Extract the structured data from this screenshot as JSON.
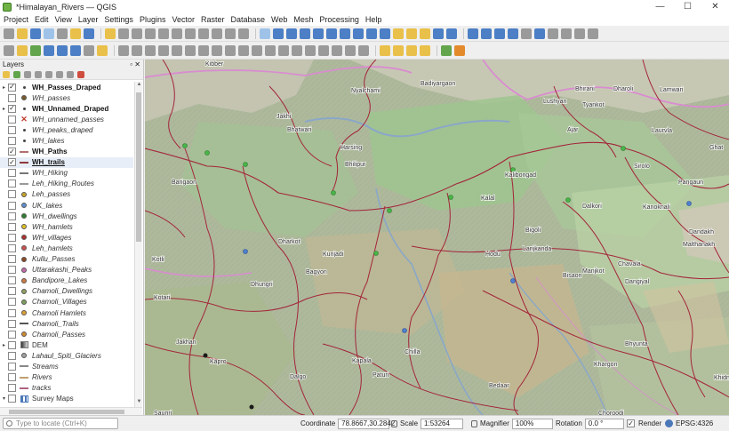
{
  "window": {
    "title": "*Himalayan_Rivers — QGIS",
    "minimize": "—",
    "maximize": "☐",
    "close": "✕"
  },
  "menu": [
    "Project",
    "Edit",
    "View",
    "Layer",
    "Settings",
    "Plugins",
    "Vector",
    "Raster",
    "Database",
    "Web",
    "Mesh",
    "Processing",
    "Help"
  ],
  "layers_panel": {
    "title": "Layers",
    "controls": "▫ ✕",
    "layers": [
      {
        "name": "WH_Passes_Draped",
        "checked": true,
        "style": "bold",
        "symbol": "tiny",
        "expander": "▸"
      },
      {
        "name": "WH_passes",
        "checked": false,
        "style": "italic",
        "symbol": "dot",
        "color": "#7a5a2a",
        "expander": ""
      },
      {
        "name": "WH_Unnamed_Draped",
        "checked": true,
        "style": "bold",
        "symbol": "tiny",
        "expander": "▸"
      },
      {
        "name": "WH_unnamed_passes",
        "checked": false,
        "style": "italic",
        "symbol": "x",
        "expander": ""
      },
      {
        "name": "WH_peaks_draped",
        "checked": false,
        "style": "italic",
        "symbol": "tiny",
        "expander": ""
      },
      {
        "name": "WH_lakes",
        "checked": false,
        "style": "italic",
        "symbol": "tiny",
        "expander": ""
      },
      {
        "name": "WH_Paths",
        "checked": true,
        "style": "bold",
        "symbol": "line",
        "color": "#b07070",
        "expander": ""
      },
      {
        "name": "WH_trails",
        "checked": true,
        "style": "bold-u",
        "symbol": "line",
        "color": "#8a3a3a",
        "expander": "",
        "selected": true
      },
      {
        "name": "WH_Hiking",
        "checked": false,
        "style": "italic",
        "symbol": "line",
        "color": "#777777",
        "expander": ""
      },
      {
        "name": "Leh_Hiking_Routes",
        "checked": false,
        "style": "italic",
        "symbol": "line",
        "color": "#999999",
        "expander": ""
      },
      {
        "name": "Leh_passes",
        "checked": false,
        "style": "italic",
        "symbol": "dot",
        "color": "#c9a227",
        "expander": ""
      },
      {
        "name": "UK_lakes",
        "checked": false,
        "style": "italic",
        "symbol": "dot",
        "color": "#5b8fcf",
        "expander": ""
      },
      {
        "name": "WH_dwellings",
        "checked": false,
        "style": "italic",
        "symbol": "dot",
        "color": "#2e7d32",
        "expander": ""
      },
      {
        "name": "WH_hamlets",
        "checked": false,
        "style": "italic",
        "symbol": "dot",
        "color": "#e0c020",
        "expander": ""
      },
      {
        "name": "WH_villages",
        "checked": false,
        "style": "italic",
        "symbol": "dot",
        "color": "#b03030",
        "expander": ""
      },
      {
        "name": "Leh_hamlets",
        "checked": false,
        "style": "italic",
        "symbol": "dot",
        "color": "#d05050",
        "expander": ""
      },
      {
        "name": "Kullu_Passes",
        "checked": false,
        "style": "italic",
        "symbol": "dot",
        "color": "#8a4a20",
        "expander": ""
      },
      {
        "name": "Uttarakashi_Peaks",
        "checked": false,
        "style": "italic",
        "symbol": "dot",
        "color": "#c46aa8",
        "expander": ""
      },
      {
        "name": "Bandipore_Lakes",
        "checked": false,
        "style": "italic",
        "symbol": "dot",
        "color": "#d07a40",
        "expander": ""
      },
      {
        "name": "Chamoli_Dwellings",
        "checked": false,
        "style": "italic",
        "symbol": "dot",
        "color": "#8fa060",
        "expander": ""
      },
      {
        "name": "Chamoli_Villages",
        "checked": false,
        "style": "italic",
        "symbol": "dot",
        "color": "#7aa05a",
        "expander": ""
      },
      {
        "name": "Chamoli Hamlets",
        "checked": false,
        "style": "italic",
        "symbol": "dot",
        "color": "#e0a030",
        "expander": ""
      },
      {
        "name": "Chamoli_Trails",
        "checked": false,
        "style": "italic",
        "symbol": "line",
        "color": "#555555",
        "expander": ""
      },
      {
        "name": "Chamoli_Passes",
        "checked": false,
        "style": "italic",
        "symbol": "dot",
        "color": "#d08a30",
        "expander": ""
      },
      {
        "name": "DEM",
        "checked": false,
        "style": "normal",
        "symbol": "dem",
        "expander": "▸"
      },
      {
        "name": "Lahaul_Spiti_Glaciers",
        "checked": false,
        "style": "italic",
        "symbol": "dot",
        "color": "#a0a0a0",
        "expander": ""
      },
      {
        "name": "Streams",
        "checked": false,
        "style": "italic",
        "symbol": "line",
        "color": "#888888",
        "expander": ""
      },
      {
        "name": "Rivers",
        "checked": false,
        "style": "italic",
        "symbol": "line",
        "color": "#c0a070",
        "expander": ""
      },
      {
        "name": "tracks",
        "checked": false,
        "style": "italic",
        "symbol": "line",
        "color": "#b06080",
        "expander": ""
      },
      {
        "name": "Survey Maps",
        "checked": false,
        "style": "normal",
        "symbol": "grid",
        "expander": "▾"
      }
    ]
  },
  "map_labels": [
    "Kibber",
    "Badiyargaon",
    "Nyalchami",
    "Bhirani",
    "Dharoli",
    "Lamwari",
    "Lushyan",
    "Tyankot",
    "Jakhi",
    "Bhatwari",
    "Harsing",
    "Ajar",
    "Laurvla",
    "Bhilipur",
    "Kalibongad",
    "Sirolo",
    "Ghat",
    "Pangaun",
    "Barigaon",
    "Kalal",
    "Dalkori",
    "Kanoknali",
    "Dandakh",
    "Malthanakh",
    "Bigoli",
    "Chavala",
    "Dharkot",
    "Kunjadi",
    "Hodu",
    "Lanjkanda",
    "Manjkot",
    "Bagyon",
    "Dhungri",
    "Dangiyal",
    "Kotari",
    "Kotli",
    "Bhyunta",
    "Jakhan",
    "Kapro",
    "Kapala",
    "Chilla",
    "Dalgo",
    "Paturi",
    "Bedaar",
    "Khargon",
    "Bisaon",
    "Chorgodi",
    "Saunri",
    "Khidna"
  ],
  "status": {
    "locate_placeholder": "Type to locate (Ctrl+K)",
    "coordinate_label": "Coordinate",
    "coordinate": "78.8667,30.2842",
    "scale_label": "Scale",
    "scale": "1:53264",
    "magnifier_label": "Magnifier",
    "magnifier": "100%",
    "rotation_label": "Rotation",
    "rotation": "0.0 °",
    "render_label": "Render",
    "crs": "EPSG:4326"
  }
}
